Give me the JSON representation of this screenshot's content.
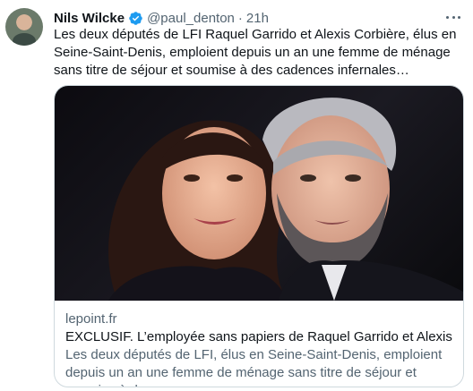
{
  "tweet": {
    "author_name": "Nils Wilcke",
    "handle": "@paul_denton",
    "separator": "·",
    "time": "21h",
    "text": "Les deux députés de LFI Raquel Garrido et Alexis Corbière, élus en Seine-Saint-Denis, emploient depuis un an une femme de ménage sans titre de séjour et soumise à des cadences infernales…",
    "verified_icon": "verified-badge-icon",
    "accent_color": "#1d9bf0"
  },
  "card": {
    "domain": "lepoint.fr",
    "title": "EXCLUSIF. L’employée sans papiers de Raquel Garrido et Alexis Corbi…",
    "description": "Les deux députés de LFI, élus en Seine-Saint-Denis, emploient depuis un an une femme de ménage sans titre de séjour et soumise à des …"
  }
}
